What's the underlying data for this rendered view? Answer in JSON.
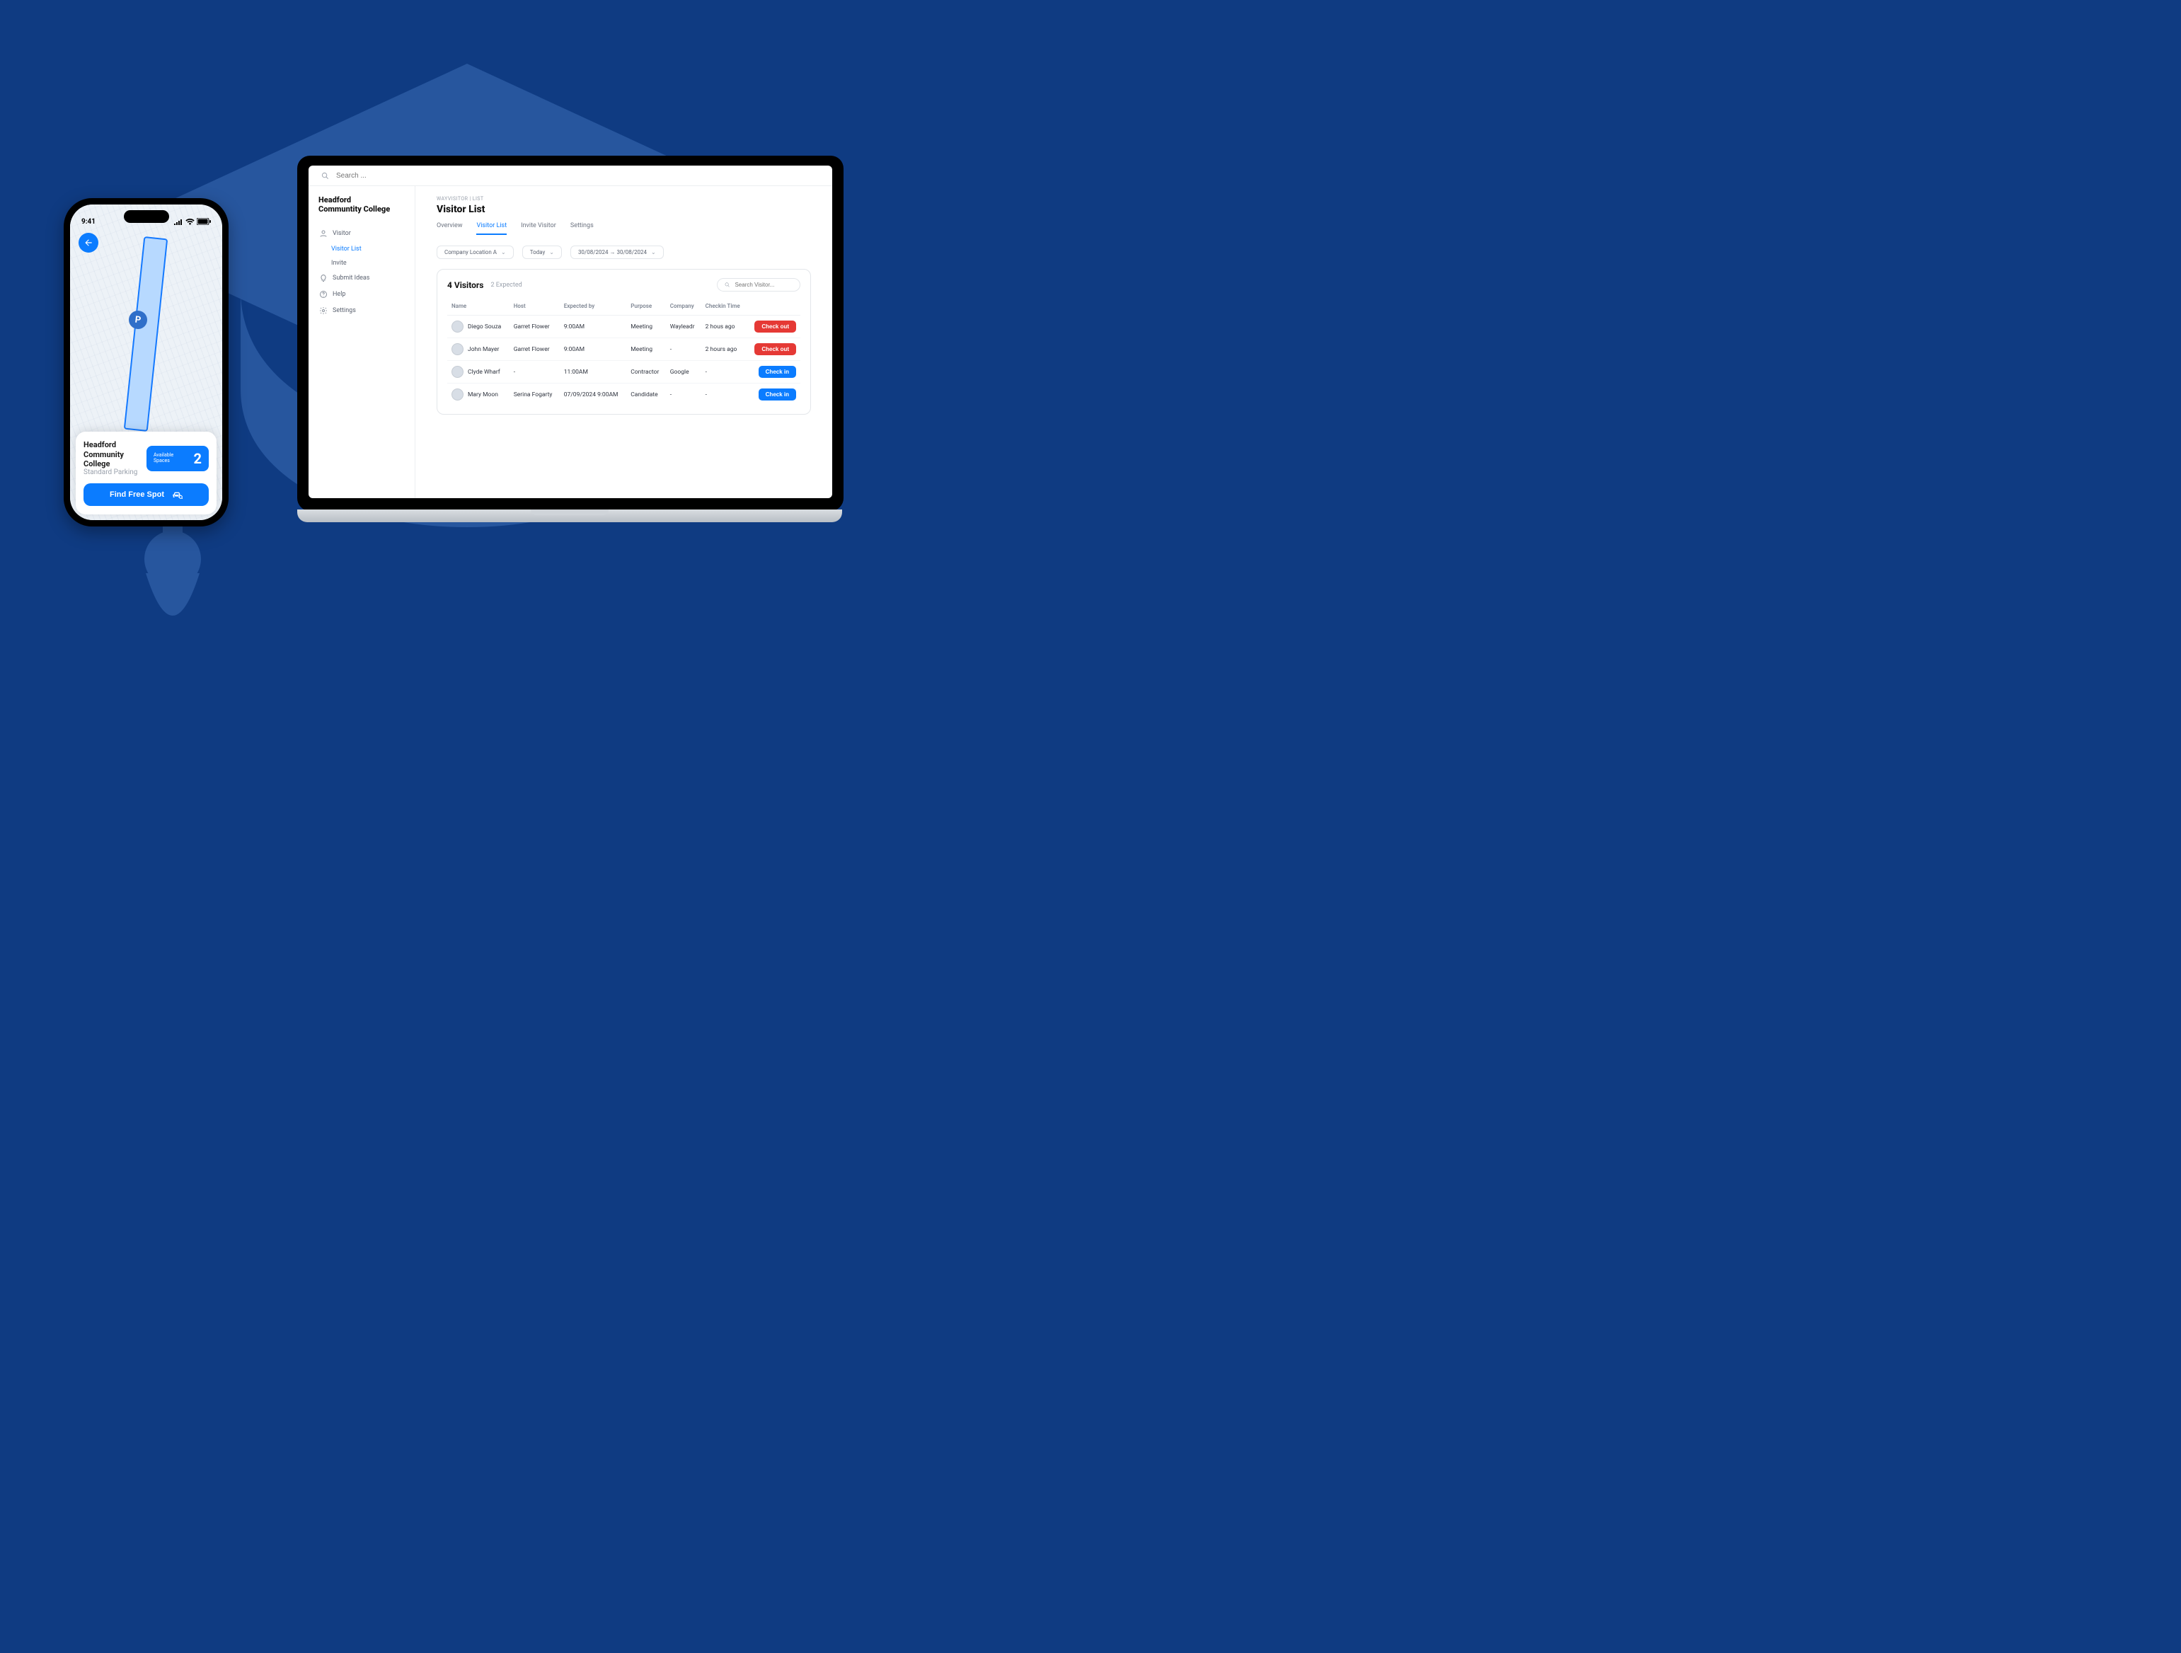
{
  "phone": {
    "status_time": "9:41",
    "title": "Headford Community College",
    "subtitle": "Standard Parking",
    "available_label": "Available\nSpaces",
    "available_count": "2",
    "cta": "Find Free Spot",
    "parking_letter": "P"
  },
  "laptop": {
    "search_placeholder": "Search ...",
    "brand": "Headford\nCommuntity College",
    "sidebar": {
      "visitor": "Visitor",
      "visitor_list": "Visitor List",
      "invite": "Invite",
      "submit_ideas": "Submit Ideas",
      "help": "Help",
      "settings": "Settings"
    },
    "crumb": "WAYVISITOR | List",
    "page_title": "Visitor List",
    "tabs": {
      "overview": "Overview",
      "visitor_list": "Visitor List",
      "invite_visitor": "Invite Visitor",
      "settings": "Settings"
    },
    "filters": {
      "location": "Company Location A",
      "range_quick": "Today",
      "range_dates": "30/08/2024 → 30/08/2024"
    },
    "visitors_header": {
      "count_label": "4 Visitors",
      "expected_label": "2 Expected",
      "search_placeholder": "Search Visitor..."
    },
    "columns": {
      "name": "Name",
      "host": "Host",
      "expected_by": "Expected by",
      "purpose": "Purpose",
      "company": "Company",
      "checkin": "Checkin Time"
    },
    "actions": {
      "check_out": "Check out",
      "check_in": "Check in"
    },
    "rows": [
      {
        "name": "Diego Souza",
        "host": "Garret Flower",
        "expected": "9:00AM",
        "purpose": "Meeting",
        "company": "Wayleadr",
        "checkin": "2 hous ago",
        "action": "out"
      },
      {
        "name": "John Mayer",
        "host": "Garret Flower",
        "expected": "9:00AM",
        "purpose": "Meeting",
        "company": "-",
        "checkin": "2 hours ago",
        "action": "out"
      },
      {
        "name": "Clyde Wharf",
        "host": "-",
        "expected": "11:00AM",
        "purpose": "Contractor",
        "company": "Google",
        "checkin": "-",
        "action": "in"
      },
      {
        "name": "Mary Moon",
        "host": "Serina Fogarty",
        "expected": "07/09/2024 9:00AM",
        "purpose": "Candidate",
        "company": "-",
        "checkin": "-",
        "action": "in"
      }
    ]
  }
}
